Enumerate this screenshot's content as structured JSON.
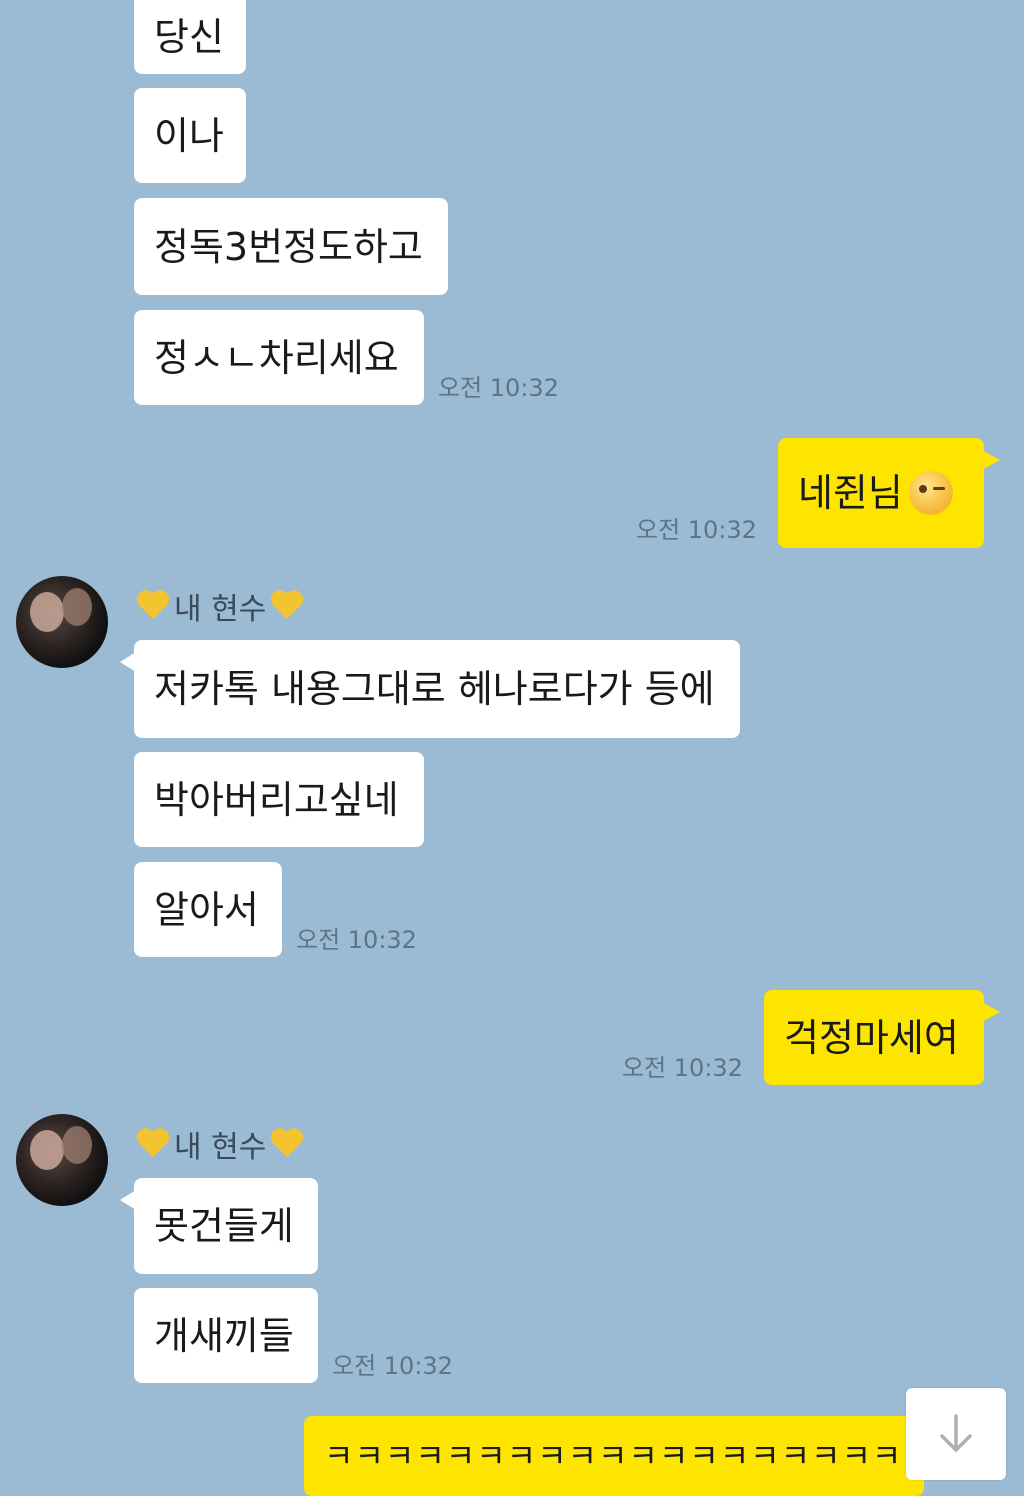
{
  "messages": {
    "m1": "당신",
    "m2": "이나",
    "m3": "정독3번정도하고",
    "m4": "정ㅅㄴ차리세요",
    "m5": "네쥔님",
    "m6": "저카톡 내용그대로 헤나로다가 등에",
    "m7": "박아버리고싶네",
    "m8": "알아서",
    "m9": "걱정마세여",
    "m10": "못건들게",
    "m11": "개새끼들",
    "m12": "ㅋㅋㅋㅋㅋㅋㅋㅋㅋㅋㅋㅋㅋㅋㅋㅋㅋㅋㅋㅋ"
  },
  "times": {
    "t1": "오전 10:32",
    "t2": "오전 10:32",
    "t3": "오전 10:32",
    "t4": "오전 10:32",
    "t5": "오전 10:32"
  },
  "sender": {
    "name": "내 현수"
  },
  "icons": {
    "heart": "yellow-heart-icon",
    "wink": "winking-face-icon",
    "scroll": "arrow-down-icon"
  },
  "colors": {
    "background": "#9bbbd4",
    "my_bubble": "#fee500",
    "their_bubble": "#ffffff"
  }
}
